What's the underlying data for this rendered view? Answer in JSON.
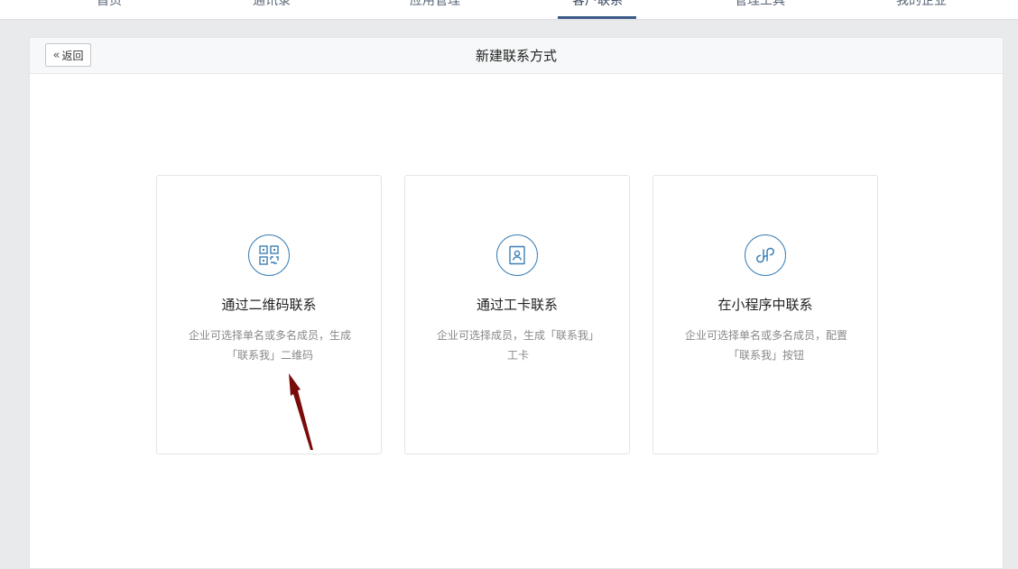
{
  "nav": {
    "items": [
      {
        "label": "首页"
      },
      {
        "label": "通讯录"
      },
      {
        "label": "应用管理"
      },
      {
        "label": "客户联系"
      },
      {
        "label": "管理工具"
      },
      {
        "label": "我的企业"
      }
    ],
    "active_index": 3,
    "accent_color": "#3a5b8a"
  },
  "header": {
    "back_label": "返回",
    "back_icon": "double-chevron-left-icon",
    "title": "新建联系方式"
  },
  "cards": [
    {
      "icon": "qr-code-icon",
      "title": "通过二维码联系",
      "desc_line1": "企业可选择单名或多名成员，生成",
      "desc_line2": "「联系我」二维码"
    },
    {
      "icon": "id-card-icon",
      "title": "通过工卡联系",
      "desc_line1": "企业可选择成员，生成「联系我」",
      "desc_line2": "工卡"
    },
    {
      "icon": "mini-program-icon",
      "title": "在小程序中联系",
      "desc_line1": "企业可选择单名或多名成员，配置",
      "desc_line2": "「联系我」按钮"
    }
  ],
  "colors": {
    "icon_blue": "#3d7fb5",
    "annotation_arrow": "#7a0b0b"
  }
}
